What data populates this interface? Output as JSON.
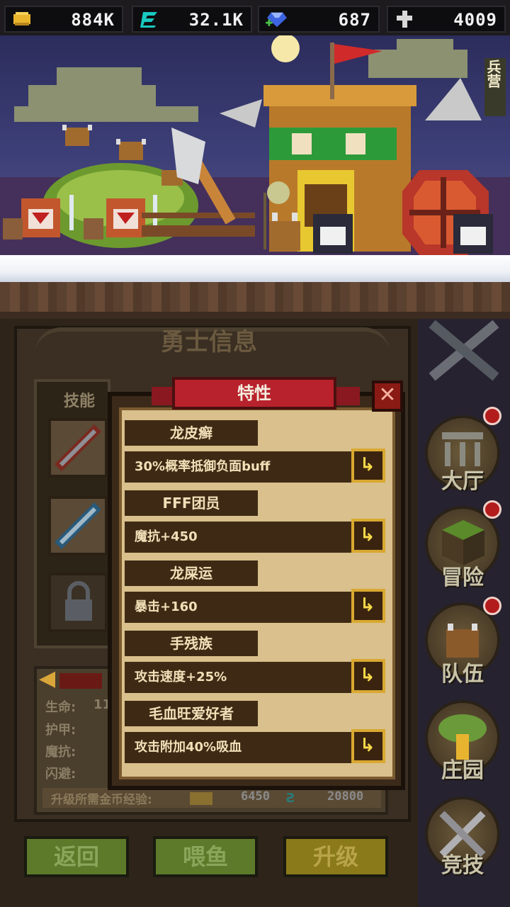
{
  "resources": {
    "gold": "884K",
    "energy": "32.1K",
    "gems": "687",
    "cross": "4009"
  },
  "scene": {
    "barracks_label": "兵营"
  },
  "panel": {
    "title": "勇士信息",
    "skill_tab": "技能",
    "stats": {
      "hp_label": "生命:",
      "hp_value": "11",
      "armor_label": "护甲:",
      "magic_res_label": "魔抗:",
      "dodge_label": "闪避:"
    },
    "upgrade_cost_label": "升级所需金币经验:",
    "upgrade_gold": "6450",
    "upgrade_exp": "20800"
  },
  "buttons": {
    "back": "返回",
    "feed": "喂鱼",
    "upgrade": "升级"
  },
  "sidebar": [
    {
      "label": "大厅"
    },
    {
      "label": "冒险"
    },
    {
      "label": "队伍"
    },
    {
      "label": "庄园"
    },
    {
      "label": "竞技"
    }
  ],
  "dialog": {
    "title": "特性",
    "close": "✕",
    "traits": [
      {
        "name": "龙皮癣",
        "desc": "30%概率抵御负面buff"
      },
      {
        "name": "FFF团员",
        "desc": "魔抗+450"
      },
      {
        "name": "龙屎运",
        "desc": "暴击+160"
      },
      {
        "name": "手残族",
        "desc": "攻击速度+25%"
      },
      {
        "name": "毛血旺爱好者",
        "desc": "攻击附加40%吸血"
      }
    ]
  },
  "colors": {
    "ribbon": "#b8222c",
    "parchment": "#d9c08c",
    "trait_bg": "#3e2a14",
    "accent_yellow": "#f7d84a"
  }
}
